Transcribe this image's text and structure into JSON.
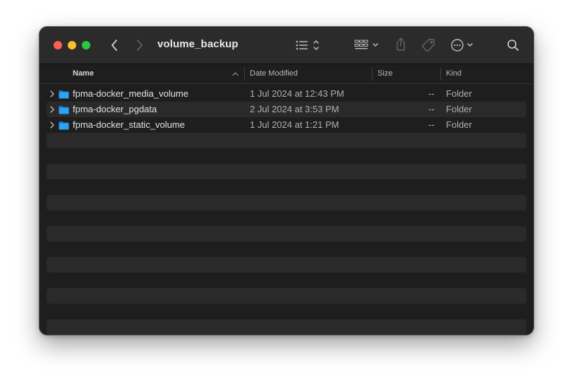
{
  "window": {
    "title": "volume_backup"
  },
  "toolbar": {
    "back_icon": "chevron-left-icon",
    "forward_icon": "chevron-right-icon",
    "view_icon": "list-view-icon",
    "group_icon": "grid-group-icon",
    "share_icon": "share-icon",
    "tag_icon": "tag-icon",
    "more_icon": "ellipsis-circle-icon",
    "search_icon": "search-icon"
  },
  "columns": {
    "name": "Name",
    "date": "Date Modified",
    "size": "Size",
    "kind": "Kind"
  },
  "files": [
    {
      "name": "fpma-docker_media_volume",
      "date": "1 Jul 2024 at 12:43 PM",
      "size": "--",
      "kind": "Folder"
    },
    {
      "name": "fpma-docker_pgdata",
      "date": "2 Jul 2024 at 3:53 PM",
      "size": "--",
      "kind": "Folder"
    },
    {
      "name": "fpma-docker_static_volume",
      "date": "1 Jul 2024 at 1:21 PM",
      "size": "--",
      "kind": "Folder"
    }
  ],
  "colors": {
    "window_bg": "#1e1e1e",
    "titlebar_bg": "#2b2b2b",
    "stripe": "#2a2a2a",
    "folder_blue": "#1e9bf0",
    "close": "#fe5f57",
    "minimize": "#febc2e",
    "zoom": "#28c840"
  }
}
